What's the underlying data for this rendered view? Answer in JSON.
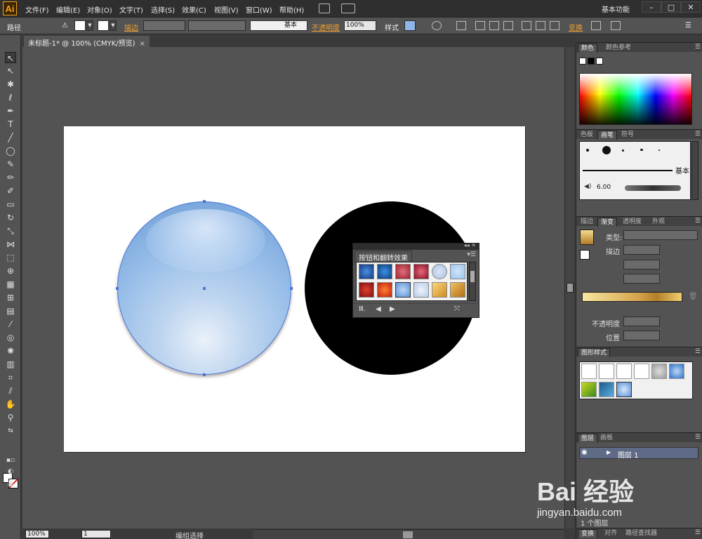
{
  "app": {
    "logo": "Ai"
  },
  "menu": {
    "items": [
      "文件(F)",
      "编辑(E)",
      "对象(O)",
      "文字(T)",
      "选择(S)",
      "效果(C)",
      "视图(V)",
      "窗口(W)",
      "帮助(H)"
    ],
    "workspace": "基本功能"
  },
  "control_bar": {
    "object_type": "路径",
    "stroke_label": "描边",
    "brush_style": "基本",
    "opacity_label": "不透明度",
    "opacity_value": "100%",
    "style_label": "样式",
    "transform_label": "变换"
  },
  "document": {
    "tab_title": "未标题-1* @ 100% (CMYK/预览)"
  },
  "floating_panel": {
    "title": "按钮和翻转效果"
  },
  "status_bar": {
    "zoom": "100%",
    "artboard_number": "1",
    "status": "编组选择"
  },
  "panels": {
    "color_tabs": [
      "颜色",
      "颜色参考"
    ],
    "brush_tabs": [
      "色板",
      "画笔",
      "符号"
    ],
    "brush_basic_label": "基本",
    "brush_size": "6.00",
    "gradient_tabs": [
      "描边",
      "渐变",
      "透明度",
      "外观"
    ],
    "gradient_type_label": "类型:",
    "gradient_stroke_label": "描边",
    "gradient_opacity_label": "不透明度",
    "gradient_location_label": "位置",
    "graphic_styles_title": "图形样式",
    "layers_tabs": [
      "图层",
      "画板"
    ],
    "layer_name": "图层 1",
    "layer_count": "1 个图层",
    "bottom_tabs": [
      "变换",
      "对齐",
      "路径查找器"
    ]
  },
  "watermark": {
    "logo_text": "Bai 经验",
    "url": "jingyan.baidu.com"
  },
  "colors": {
    "accent": "#f0a030",
    "selection": "#4a74d8",
    "logo": "#f7a21b"
  }
}
